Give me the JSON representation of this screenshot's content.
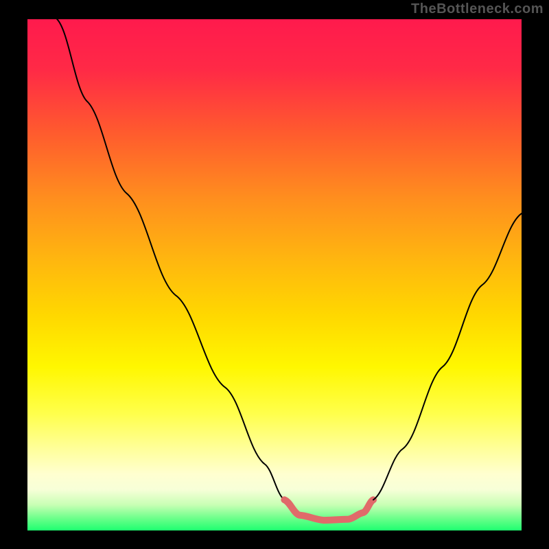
{
  "watermark": "TheBottleneck.com",
  "chart_data": {
    "type": "line",
    "title": "",
    "xlabel": "",
    "ylabel": "",
    "xlim": [
      0,
      100
    ],
    "ylim": [
      0,
      100
    ],
    "gradient_stops": [
      {
        "pct": 0,
        "color": "#ff1a4d"
      },
      {
        "pct": 10,
        "color": "#ff2a46"
      },
      {
        "pct": 22,
        "color": "#ff5a2e"
      },
      {
        "pct": 35,
        "color": "#ff8e1e"
      },
      {
        "pct": 47,
        "color": "#ffb60f"
      },
      {
        "pct": 58,
        "color": "#ffd800"
      },
      {
        "pct": 68,
        "color": "#fff700"
      },
      {
        "pct": 77,
        "color": "#ffff4a"
      },
      {
        "pct": 84,
        "color": "#ffff9a"
      },
      {
        "pct": 89,
        "color": "#ffffd0"
      },
      {
        "pct": 92,
        "color": "#f7ffd8"
      },
      {
        "pct": 95,
        "color": "#c8ffb4"
      },
      {
        "pct": 97.5,
        "color": "#70ff8c"
      },
      {
        "pct": 100,
        "color": "#1eff70"
      }
    ],
    "series": [
      {
        "name": "left-descent",
        "stroke": "#000000",
        "stroke_width": 2,
        "points": [
          {
            "x": 6,
            "y": 100
          },
          {
            "x": 12,
            "y": 84
          },
          {
            "x": 20,
            "y": 66
          },
          {
            "x": 30,
            "y": 46
          },
          {
            "x": 40,
            "y": 28
          },
          {
            "x": 48,
            "y": 13
          },
          {
            "x": 52,
            "y": 6
          }
        ]
      },
      {
        "name": "trough-highlight",
        "stroke": "#e06a6a",
        "stroke_width": 10,
        "points": [
          {
            "x": 52,
            "y": 6
          },
          {
            "x": 55,
            "y": 3
          },
          {
            "x": 60,
            "y": 2
          },
          {
            "x": 65,
            "y": 2.2
          },
          {
            "x": 68,
            "y": 3.5
          },
          {
            "x": 70,
            "y": 6
          }
        ]
      },
      {
        "name": "right-ascent",
        "stroke": "#000000",
        "stroke_width": 2,
        "points": [
          {
            "x": 70,
            "y": 6
          },
          {
            "x": 76,
            "y": 16
          },
          {
            "x": 84,
            "y": 32
          },
          {
            "x": 92,
            "y": 48
          },
          {
            "x": 100,
            "y": 62
          }
        ]
      }
    ]
  }
}
